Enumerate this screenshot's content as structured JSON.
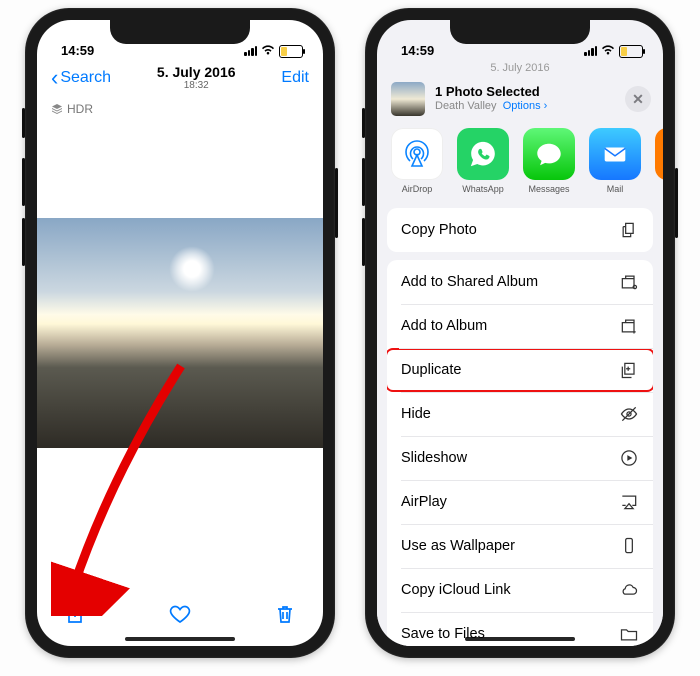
{
  "status": {
    "time": "14:59"
  },
  "left": {
    "back_label": "Search",
    "date": "5. July 2016",
    "time": "18:32",
    "edit_label": "Edit",
    "hdr_badge": "HDR"
  },
  "right": {
    "peek_date": "5. July 2016",
    "header": {
      "title": "1 Photo Selected",
      "location": "Death Valley",
      "options_label": "Options"
    },
    "apps": [
      {
        "name": "AirDrop"
      },
      {
        "name": "WhatsApp"
      },
      {
        "name": "Messages"
      },
      {
        "name": "Mail"
      }
    ],
    "actions_single": "Copy Photo",
    "actions": [
      "Add to Shared Album",
      "Add to Album",
      "Duplicate",
      "Hide",
      "Slideshow",
      "AirPlay",
      "Use as Wallpaper",
      "Copy iCloud Link",
      "Save to Files"
    ]
  }
}
